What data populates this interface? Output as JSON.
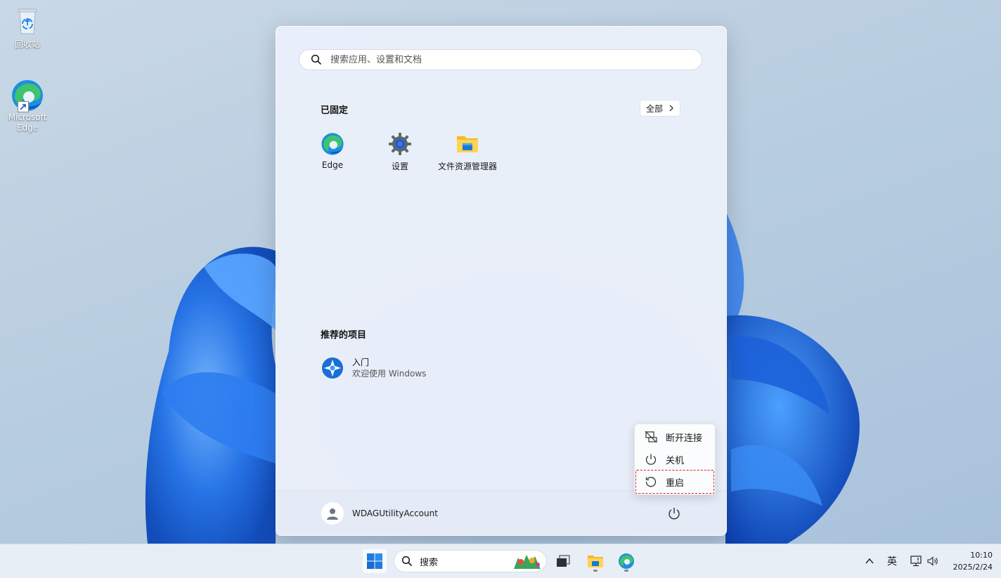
{
  "desktop": {
    "icons": [
      {
        "label": "回收站",
        "icon": "recycle-bin-icon"
      },
      {
        "label": "Microsoft Edge",
        "icon": "edge-icon"
      }
    ]
  },
  "start_menu": {
    "search": {
      "placeholder": "搜索应用、设置和文档"
    },
    "pinned": {
      "title": "已固定",
      "all_button": "全部",
      "apps": [
        {
          "label": "Edge",
          "icon": "edge-icon"
        },
        {
          "label": "设置",
          "icon": "settings-gear-icon"
        },
        {
          "label": "文件资源管理器",
          "icon": "folder-icon"
        }
      ]
    },
    "recommended": {
      "title": "推荐的项目",
      "items": [
        {
          "title": "入门",
          "subtitle": "欢迎使用 Windows",
          "icon": "get-started-icon"
        }
      ]
    },
    "user": {
      "name": "WDAGUtilityAccount"
    },
    "power_menu": {
      "items": [
        {
          "label": "断开连接",
          "icon": "disconnect-icon"
        },
        {
          "label": "关机",
          "icon": "power-icon"
        },
        {
          "label": "重启",
          "icon": "restart-icon"
        }
      ],
      "highlighted": "重启"
    }
  },
  "taskbar": {
    "search_label": "搜索",
    "tray": {
      "ime": "英",
      "time": "10:10",
      "date": "2025/2/24"
    }
  },
  "colors": {
    "accent": "#0067c0",
    "highlight": "#e02020"
  }
}
